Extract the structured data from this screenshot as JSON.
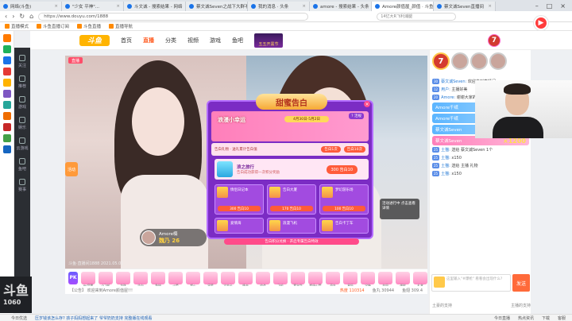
{
  "browser": {
    "tabs": [
      {
        "label": "网络(斗鱼)",
        "active": false
      },
      {
        "label": "\"少女 平神\"...",
        "active": false
      },
      {
        "label": "斗文诚 - 搜索结果 - 网络",
        "active": false
      },
      {
        "label": "蔡文诚Seven之战下大群不",
        "active": false
      },
      {
        "label": "我的消息 · 头条",
        "active": false
      },
      {
        "label": "amore - 搜索结果 - 头条",
        "active": false
      },
      {
        "label": "Amore颜值屋_颜值 · 斗鱼",
        "active": true
      },
      {
        "label": "蔡文诚Seven直播间",
        "active": false
      }
    ],
    "url": "https://www.douyu.com/1888",
    "search_placeholder": "14亿大R飞利浦腿",
    "bookmarks": [
      "直播模式",
      "斗鱼直播订阅",
      "斗鱼直播",
      "直播导航"
    ]
  },
  "site": {
    "logo": "斗鱼",
    "nav": [
      "首页",
      "直播",
      "分类",
      "视频",
      "游戏",
      "鱼吧"
    ],
    "nav_active": "直播",
    "promo_label": "五五开黑节",
    "sidenav": [
      "关注",
      "推荐",
      "游戏",
      "娱乐",
      "云游戏",
      "鱼吧",
      "赛事"
    ],
    "header_avatar_num": "7"
  },
  "video": {
    "live_tag": "直播",
    "left_badge": "活动",
    "streamer_name": "Amore楠",
    "streamer_score": "魏乃 26",
    "footer_text": "斗鱼·直播间1888 2021.05.01",
    "corner_card_text": "活动进行中 点击查看详情"
  },
  "modal": {
    "title": "甜蜜告白",
    "subtitle": "浪漫小幸运",
    "date": "4月30日-5月2日",
    "rule_label": "? 活规",
    "row1_text": "告白礼物 · 送礼累计告白值",
    "row1_btn1": "告白1次",
    "row1_btn2": "告白10次",
    "big_gift_name": "浪之旅行",
    "big_gift_desc": "告白成功获得一次积分奖励",
    "big_gift_price": "300 告白10",
    "grid": [
      {
        "name": "情侣日记本",
        "price": "300 告白10"
      },
      {
        "name": "告白大厦",
        "price": "170 告白10"
      },
      {
        "name": "梦幻游乐场",
        "price": "100 告白10"
      },
      {
        "name": "爱情海",
        "price": ""
      },
      {
        "name": "浪漫飞机",
        "price": ""
      },
      {
        "name": "告白卡丁车",
        "price": ""
      }
    ],
    "footer": "告白积分兑换 · 开启专属告白特效"
  },
  "panel": {
    "rank": [
      "7",
      "",
      "",
      ""
    ],
    "messages": [
      {
        "user": "蔡文诚Seven",
        "text": "欢迎来到直播间",
        "level": "30"
      },
      {
        "user": "用户",
        "text": "主播好美",
        "level": "12"
      },
      {
        "user": "Amore",
        "text": "谢谢大家的支持",
        "level": "20"
      }
    ],
    "banners": [
      {
        "name": "Amore千纸",
        "num": "",
        "style": "blue"
      },
      {
        "name": "Amore千纸",
        "num": "×4",
        "style": "blue"
      },
      {
        "name": "蔡文诚Seven",
        "num": "",
        "style": "blue"
      },
      {
        "name": "蔡文诚Seven",
        "num": "×1200",
        "style": "pink"
      }
    ],
    "messages2": [
      {
        "user": "土猫",
        "text": "送给 蔡文诚Seven 1个",
        "level": "25"
      },
      {
        "user": "土猫",
        "text": "x150",
        "level": "25"
      },
      {
        "user": "土猫",
        "text": "送给 主播 礼物",
        "level": "25"
      },
      {
        "user": "土猫",
        "text": "x150",
        "level": "25"
      }
    ],
    "input_placeholder": "这里输入\"#爆枪\" 看看会出现什么?",
    "send_label": "发送",
    "footer_left": "土豪的支持",
    "footer_right": "主播的支持"
  },
  "giftbar": {
    "pk_label": "PK",
    "items": [
      "PK竞猜",
      "小飞机",
      "龙珠",
      "告白",
      "鱼翅",
      "火箭",
      "超火",
      "宠爱",
      "太空卡",
      "情书",
      "约会",
      "飞机",
      "嘉年华",
      "超级火箭",
      "豪车",
      "星辰",
      "宝箱",
      "花园",
      "蛋糕",
      "礼盒"
    ]
  },
  "stats": {
    "left": "【公告】 欢迎来到Amore颜值屋!!!",
    "viewers": "热度 110314",
    "fish": "鱼丸 30944",
    "gift": "鱼翅 309.4"
  },
  "bottombar": {
    "left": "今日优选",
    "news": "压岁钱该怎么存?  孩子妈妈想起来了  爷爷奶奶支持  完整版在线观看",
    "right": [
      "今日直播",
      "热点资讯",
      "下载",
      "客服"
    ]
  },
  "brand_ghost": {
    "line1": "斗鱼",
    "line2": "1060"
  }
}
